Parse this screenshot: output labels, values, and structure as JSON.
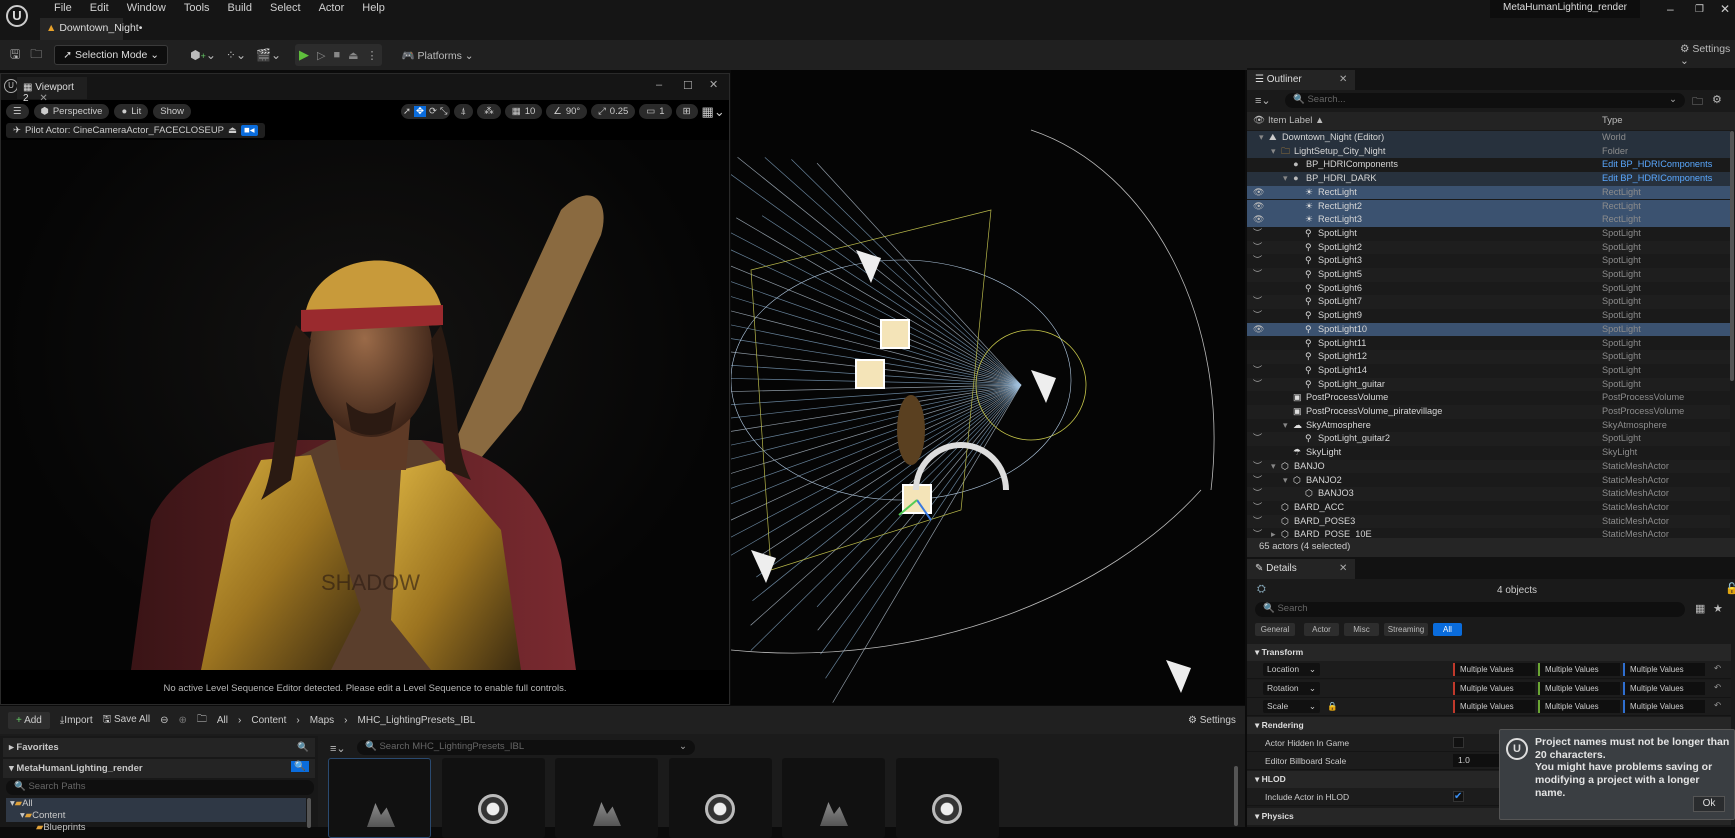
{
  "app": {
    "menu": [
      "File",
      "Edit",
      "Window",
      "Tools",
      "Build",
      "Select",
      "Actor",
      "Help"
    ],
    "doc_tab": "Downtown_Night•",
    "project_name": "MetaHumanLighting_render",
    "window_controls": [
      "–",
      "❐",
      "✕"
    ]
  },
  "toolbar": {
    "selection_mode": "Selection Mode",
    "platforms": "Platforms",
    "settings": "Settings"
  },
  "viewport2": {
    "tab": "Viewport 2",
    "perspective": "Perspective",
    "lit": "Lit",
    "show": "Show",
    "grid_snap": "10",
    "angle_snap": "90°",
    "scale_snap": "0.25",
    "camera_speed": "1",
    "pilot_actor": "Pilot Actor: CineCameraActor_FACECLOSEUP",
    "message": "No active Level Sequence Editor detected. Please edit a Level Sequence to enable full controls.",
    "chest_text": "SHADOW"
  },
  "outliner": {
    "title": "Outliner",
    "search_placeholder": "Search...",
    "col_label": "Item Label ▲",
    "col_type": "Type",
    "status": "65 actors (4 selected)",
    "rows": [
      {
        "label": "Downtown_Night (Editor)",
        "type": "World",
        "indent": 1,
        "arrow": "▾",
        "icon": "world",
        "eye": "",
        "state": "par"
      },
      {
        "label": "LightSetup_City_Night",
        "type": "Folder",
        "indent": 2,
        "arrow": "▾",
        "icon": "folder",
        "eye": "",
        "state": "par"
      },
      {
        "label": "BP_HDRIComponents",
        "type": "Edit BP_HDRIComponents",
        "link": true,
        "indent": 3,
        "arrow": "",
        "icon": "blueprint",
        "eye": "",
        "state": ""
      },
      {
        "label": "BP_HDRI_DARK",
        "type": "Edit BP_HDRIComponents",
        "link": true,
        "indent": 3,
        "arrow": "▾",
        "icon": "blueprint",
        "eye": "",
        "state": "par"
      },
      {
        "label": "RectLight",
        "type": "RectLight",
        "indent": 4,
        "arrow": "",
        "icon": "rectlight",
        "eye": "open",
        "state": "sel"
      },
      {
        "label": "RectLight2",
        "type": "RectLight",
        "indent": 4,
        "arrow": "",
        "icon": "rectlight",
        "eye": "open",
        "state": "sel"
      },
      {
        "label": "RectLight3",
        "type": "RectLight",
        "indent": 4,
        "arrow": "",
        "icon": "rectlight",
        "eye": "open",
        "state": "sel"
      },
      {
        "label": "SpotLight",
        "type": "SpotLight",
        "indent": 4,
        "arrow": "",
        "icon": "spotlight",
        "eye": "closed",
        "state": ""
      },
      {
        "label": "SpotLight2",
        "type": "SpotLight",
        "indent": 4,
        "arrow": "",
        "icon": "spotlight",
        "eye": "closed",
        "state": "alt"
      },
      {
        "label": "SpotLight3",
        "type": "SpotLight",
        "indent": 4,
        "arrow": "",
        "icon": "spotlight",
        "eye": "closed",
        "state": ""
      },
      {
        "label": "SpotLight5",
        "type": "SpotLight",
        "indent": 4,
        "arrow": "",
        "icon": "spotlight",
        "eye": "closed",
        "state": "alt"
      },
      {
        "label": "SpotLight6",
        "type": "SpotLight",
        "indent": 4,
        "arrow": "",
        "icon": "spotlight",
        "eye": "",
        "state": ""
      },
      {
        "label": "SpotLight7",
        "type": "SpotLight",
        "indent": 4,
        "arrow": "",
        "icon": "spotlight",
        "eye": "closed",
        "state": "alt"
      },
      {
        "label": "SpotLight9",
        "type": "SpotLight",
        "indent": 4,
        "arrow": "",
        "icon": "spotlight",
        "eye": "closed",
        "state": ""
      },
      {
        "label": "SpotLight10",
        "type": "SpotLight",
        "indent": 4,
        "arrow": "",
        "icon": "spotlight",
        "eye": "open",
        "state": "sel"
      },
      {
        "label": "SpotLight11",
        "type": "SpotLight",
        "indent": 4,
        "arrow": "",
        "icon": "spotlight",
        "eye": "",
        "state": ""
      },
      {
        "label": "SpotLight12",
        "type": "SpotLight",
        "indent": 4,
        "arrow": "",
        "icon": "spotlight",
        "eye": "",
        "state": "alt"
      },
      {
        "label": "SpotLight14",
        "type": "SpotLight",
        "indent": 4,
        "arrow": "",
        "icon": "spotlight",
        "eye": "closed",
        "state": ""
      },
      {
        "label": "SpotLight_guitar",
        "type": "SpotLight",
        "indent": 4,
        "arrow": "",
        "icon": "spotlight",
        "eye": "closed",
        "state": "alt"
      },
      {
        "label": "PostProcessVolume",
        "type": "PostProcessVolume",
        "indent": 3,
        "arrow": "",
        "icon": "volume",
        "eye": "",
        "state": ""
      },
      {
        "label": "PostProcessVolume_piratevillage",
        "type": "PostProcessVolume",
        "indent": 3,
        "arrow": "",
        "icon": "volume",
        "eye": "",
        "state": "alt"
      },
      {
        "label": "SkyAtmosphere",
        "type": "SkyAtmosphere",
        "indent": 3,
        "arrow": "▾",
        "icon": "sky",
        "eye": "",
        "state": ""
      },
      {
        "label": "SpotLight_guitar2",
        "type": "SpotLight",
        "indent": 4,
        "arrow": "",
        "icon": "spotlight",
        "eye": "closed",
        "state": "alt"
      },
      {
        "label": "SkyLight",
        "type": "SkyLight",
        "indent": 3,
        "arrow": "",
        "icon": "skylight",
        "eye": "",
        "state": ""
      },
      {
        "label": "BANJO",
        "type": "StaticMeshActor",
        "indent": 2,
        "arrow": "▾",
        "icon": "mesh",
        "eye": "closed",
        "state": "alt"
      },
      {
        "label": "BANJO2",
        "type": "StaticMeshActor",
        "indent": 3,
        "arrow": "▾",
        "icon": "mesh",
        "eye": "closed",
        "state": ""
      },
      {
        "label": "BANJO3",
        "type": "StaticMeshActor",
        "indent": 4,
        "arrow": "",
        "icon": "mesh",
        "eye": "closed",
        "state": "alt"
      },
      {
        "label": "BARD_ACC",
        "type": "StaticMeshActor",
        "indent": 2,
        "arrow": "",
        "icon": "mesh",
        "eye": "closed",
        "state": ""
      },
      {
        "label": "BARD_POSE3",
        "type": "StaticMeshActor",
        "indent": 2,
        "arrow": "",
        "icon": "mesh",
        "eye": "closed",
        "state": "alt"
      },
      {
        "label": "BARD_POSE_10E",
        "type": "StaticMeshActor",
        "indent": 2,
        "arrow": "▸",
        "icon": "mesh",
        "eye": "closed",
        "state": ""
      }
    ]
  },
  "details": {
    "title": "Details",
    "objects": "4 objects",
    "search_placeholder": "Search",
    "filters": [
      "General",
      "Actor",
      "Misc",
      "Streaming",
      "All"
    ],
    "active_filter": "All",
    "sections": {
      "transform": "Transform",
      "rendering": "Rendering",
      "hlod": "HLOD",
      "physics": "Physics"
    },
    "transform_rows": [
      "Location",
      "Rotation",
      "Scale"
    ],
    "multiple_values": "Multiple Values",
    "actor_hidden": "Actor Hidden In Game",
    "actor_hidden_checked": false,
    "billboard_scale": "Editor Billboard Scale",
    "billboard_value": "1.0",
    "include_hlod": "Include Actor in HLOD",
    "include_hlod_checked": true,
    "accent": "#0a6cdc"
  },
  "popup": {
    "message": "Project names must not be longer than 20 characters.\nYou might have problems saving or modifying a project with a longer name.",
    "ok": "Ok"
  },
  "content_browser": {
    "add": "Add",
    "import": "Import",
    "save_all": "Save All",
    "breadcrumb": [
      "All",
      "Content",
      "Maps",
      "MHC_LightingPresets_IBL"
    ],
    "settings": "Settings",
    "favorites": "Favorites",
    "project": "MetaHumanLighting_render",
    "search_paths_placeholder": "Search Paths",
    "search_assets_placeholder": "Search MHC_LightingPresets_IBL",
    "tree": [
      "All",
      "Content",
      "Blueprints"
    ],
    "tiles": [
      "map",
      "blueprint",
      "map",
      "blueprint",
      "map",
      "blueprint"
    ]
  }
}
